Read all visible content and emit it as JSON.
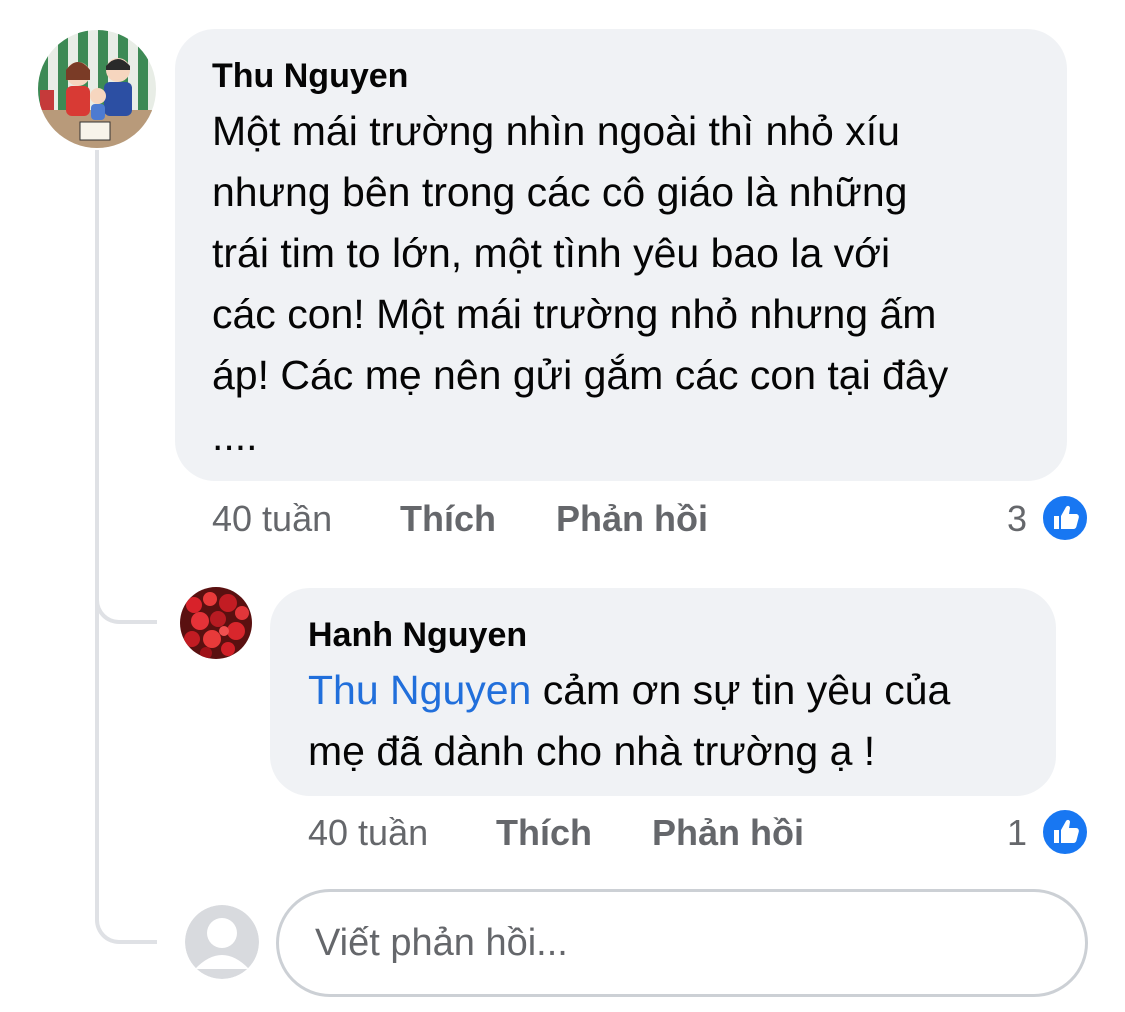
{
  "comment": {
    "author": "Thu Nguyen",
    "text_lines": [
      "Một mái trường nhìn ngoài thì nhỏ xíu",
      "nhưng bên trong các cô giáo là những",
      "trái tim to lớn, một tình yêu bao la với",
      "các con! Một mái trường nhỏ nhưng ấm",
      "áp! Các mẹ nên gửi gắm các con tại đây",
      "...."
    ],
    "timestamp": "40 tuần",
    "like_label": "Thích",
    "reply_label": "Phản hồi",
    "reaction_count": "3",
    "reaction_icon": "like-icon"
  },
  "reply": {
    "author": "Hanh Nguyen",
    "mention": "Thu Nguyen",
    "text_line1_rest": " cảm ơn sự tin yêu của",
    "text_line2": "mẹ đã dành cho nhà trường ạ !",
    "timestamp": "40 tuần",
    "like_label": "Thích",
    "reply_label": "Phản hồi",
    "reaction_count": "1",
    "reaction_icon": "like-icon"
  },
  "composer": {
    "placeholder": "Viết phản hồi..."
  },
  "colors": {
    "bubble_bg": "#f0f2f5",
    "meta_text": "#65676b",
    "mention_link": "#216fdb",
    "like_badge": "#1877f2",
    "thread_line": "#dfe1e5"
  }
}
